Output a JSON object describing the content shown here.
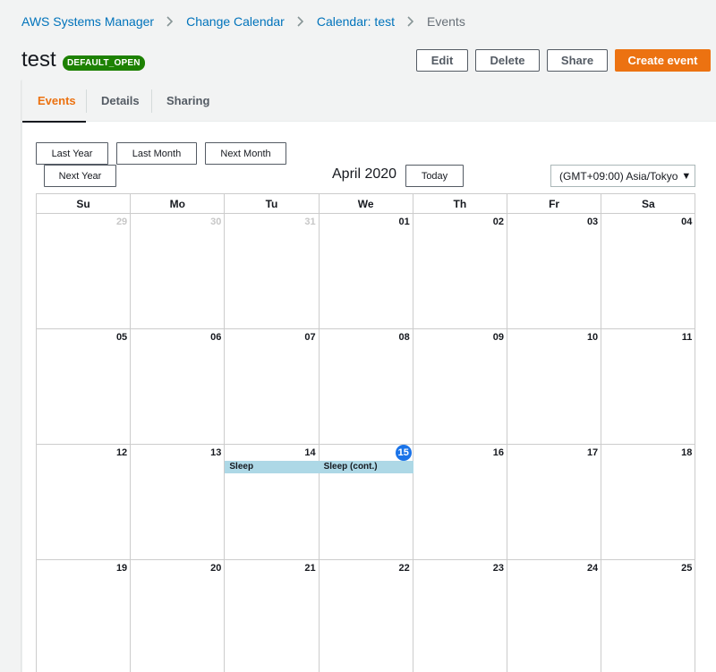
{
  "breadcrumb": [
    {
      "label": "AWS Systems Manager"
    },
    {
      "label": "Change Calendar"
    },
    {
      "label": "Calendar: test"
    }
  ],
  "breadcrumb_current": "Events",
  "title": "test",
  "badge": "DEFAULT_OPEN",
  "actions": {
    "edit": "Edit",
    "delete": "Delete",
    "share": "Share",
    "create": "Create event"
  },
  "tabs": {
    "events": "Events",
    "details": "Details",
    "sharing": "Sharing"
  },
  "calendar": {
    "last_year": "Last Year",
    "last_month": "Last Month",
    "next_month": "Next Month",
    "next_year": "Next Year",
    "today": "Today",
    "month_label": "April 2020",
    "timezone": "(GMT+09:00) Asia/Tokyo",
    "weekdays": [
      "Su",
      "Mo",
      "Tu",
      "We",
      "Th",
      "Fr",
      "Sa"
    ],
    "weeks": [
      [
        {
          "day": "29",
          "other": true
        },
        {
          "day": "30",
          "other": true
        },
        {
          "day": "31",
          "other": true
        },
        {
          "day": "01"
        },
        {
          "day": "02"
        },
        {
          "day": "03"
        },
        {
          "day": "04"
        }
      ],
      [
        {
          "day": "05"
        },
        {
          "day": "06"
        },
        {
          "day": "07"
        },
        {
          "day": "08"
        },
        {
          "day": "09"
        },
        {
          "day": "10"
        },
        {
          "day": "11"
        }
      ],
      [
        {
          "day": "12"
        },
        {
          "day": "13"
        },
        {
          "day": "14"
        },
        {
          "day": "15",
          "today": true
        },
        {
          "day": "16"
        },
        {
          "day": "17"
        },
        {
          "day": "18"
        }
      ],
      [
        {
          "day": "19"
        },
        {
          "day": "20"
        },
        {
          "day": "21"
        },
        {
          "day": "22"
        },
        {
          "day": "23"
        },
        {
          "day": "24"
        },
        {
          "day": "25"
        }
      ]
    ],
    "events": [
      {
        "label": "Sleep",
        "week": 2,
        "col": 2
      },
      {
        "label": "Sleep (cont.)",
        "week": 2,
        "col": 3
      }
    ],
    "colors": {
      "today": "#1a73e8",
      "event": "#add8e6"
    }
  }
}
